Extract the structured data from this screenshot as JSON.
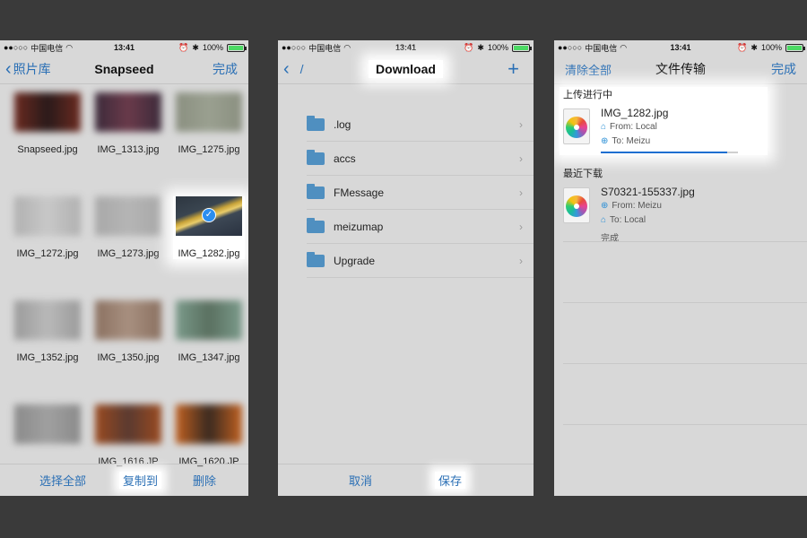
{
  "status": {
    "carrier": "中国电信",
    "time": "13:41",
    "battery": "100%",
    "battery_level": 1.0
  },
  "panel1": {
    "nav": {
      "back": "照片库",
      "title": "Snapseed",
      "done": "完成"
    },
    "photos": [
      {
        "name": "Snapseed.jpg",
        "c1": "#6b2a20",
        "c2": "#2a1a1a"
      },
      {
        "name": "IMG_1313.jpg",
        "c1": "#3b2a3a",
        "c2": "#6a3a4a"
      },
      {
        "name": "IMG_1275.jpg",
        "c1": "#8a8f80",
        "c2": "#9aa090"
      },
      {
        "name": "IMG_1272.jpg",
        "c1": "#b0b0b0",
        "c2": "#c8c8c8"
      },
      {
        "name": "IMG_1273.jpg",
        "c1": "#a8a8a8",
        "c2": "#b5b5b5"
      },
      {
        "name": "IMG_1282.jpg",
        "selected": true
      },
      {
        "name": "IMG_1352.jpg",
        "c1": "#9a9a9a",
        "c2": "#b9b9b9"
      },
      {
        "name": "IMG_1350.jpg",
        "c1": "#8a7060",
        "c2": "#a89080"
      },
      {
        "name": "IMG_1347.jpg",
        "c1": "#7a9a8a",
        "c2": "#5a7060"
      },
      {
        "name": "",
        "c1": "#8a8a8a",
        "c2": "#a0a0a0"
      },
      {
        "name": "IMG_1616.JP",
        "c1": "#9a4a20",
        "c2": "#5a3a30"
      },
      {
        "name": "IMG_1620.JP",
        "c1": "#c06020",
        "c2": "#3a2a20"
      }
    ],
    "toolbar": {
      "select_all": "选择全部",
      "copy_to": "复制到",
      "delete": "删除"
    }
  },
  "panel2": {
    "nav": {
      "back": "/",
      "title": "Download",
      "add": "+"
    },
    "folders": [
      ".log",
      "accs",
      "FMessage",
      "meizumap",
      "Upgrade"
    ],
    "toolbar": {
      "cancel": "取消",
      "save": "保存"
    }
  },
  "panel3": {
    "nav": {
      "clear": "清除全部",
      "title": "文件传输",
      "done": "完成"
    },
    "uploading": {
      "header": "上传进行中",
      "file": "IMG_1282.jpg",
      "from": "From: Local",
      "to": "To: Meizu",
      "progress": 0.92
    },
    "recent": {
      "header": "最近下载",
      "file": "S70321-155337.jpg",
      "from": "From: Meizu",
      "to": "To: Local",
      "status": "完成"
    }
  }
}
